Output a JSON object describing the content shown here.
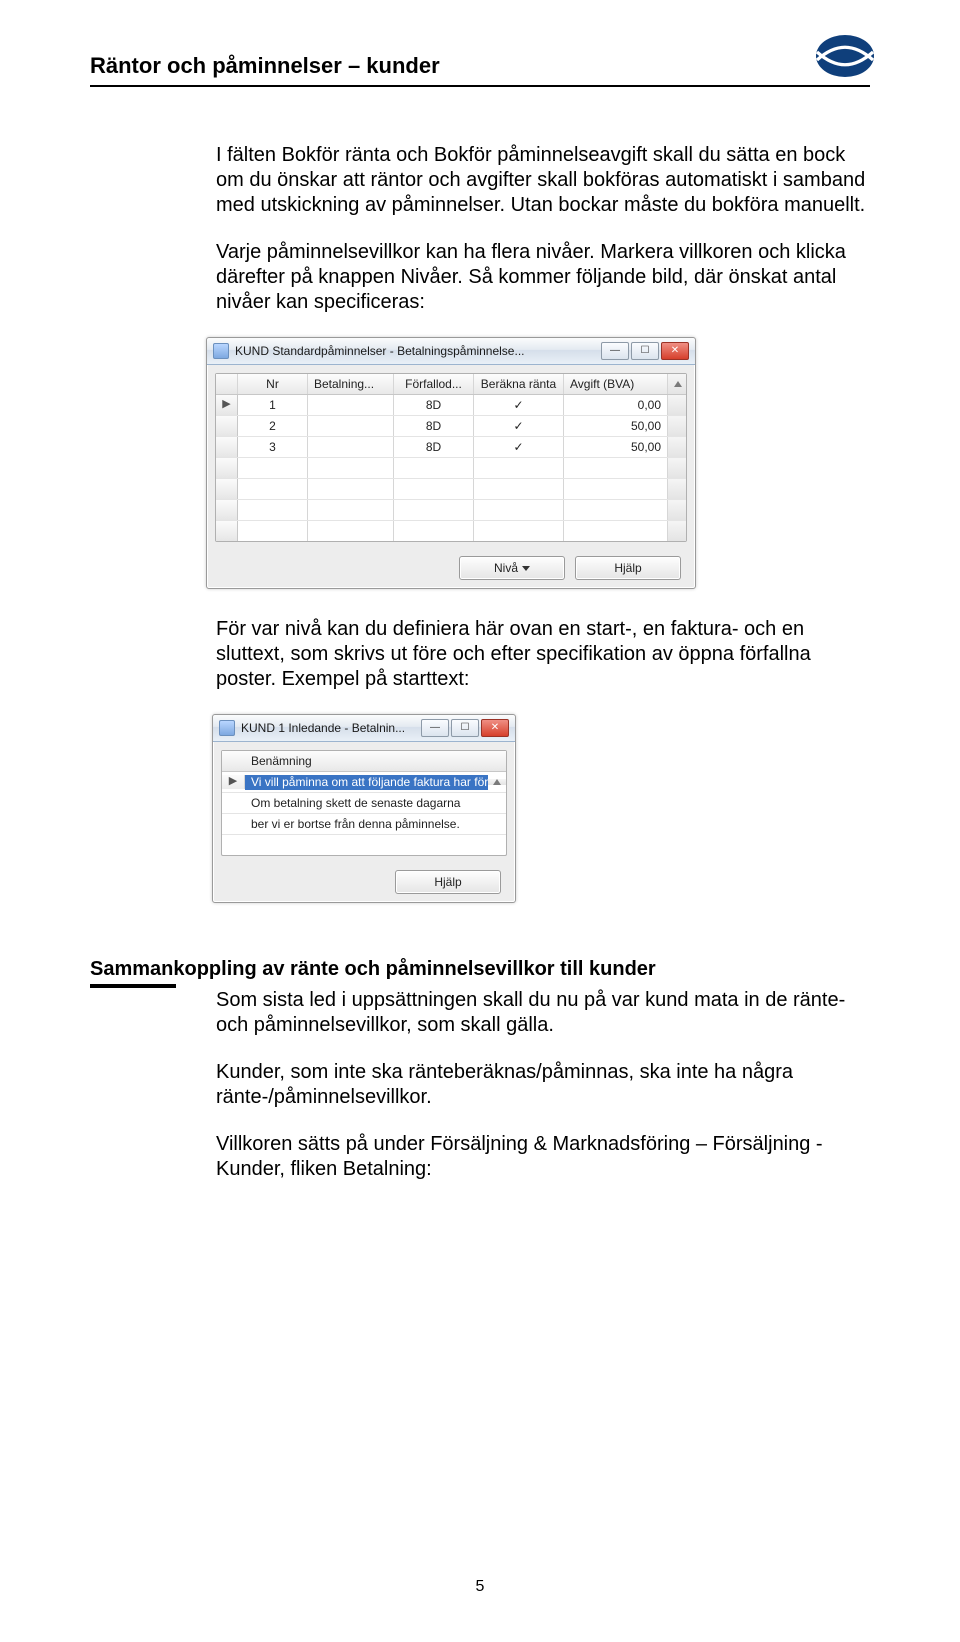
{
  "header": {
    "title": "Räntor och påminnelser – kunder"
  },
  "paragraphs": {
    "p1": "I fälten Bokför ränta och Bokför påminnelseavgift skall du sätta en bock om du önskar att räntor och avgifter skall bokföras automatiskt i samband med utskickning av påminnelser. Utan bockar måste du bokföra manuellt.",
    "p2": "Varje påminnelsevillkor kan ha flera nivåer. Markera villkoren och klicka därefter på knappen Nivåer. Så kommer följande bild, där önskat antal nivåer kan specificeras:",
    "p3": "För var nivå kan du definiera här ovan en start-, en faktura- och en sluttext, som skrivs ut före och efter specifikation av öppna förfallna poster. Exempel på starttext:"
  },
  "section2": {
    "heading": "Sammankoppling av ränte och påminnelsevillkor till kunder",
    "p1": "Som sista led i uppsättningen skall du nu på var kund mata in de ränte- och påminnelsevillkor, som skall gälla.",
    "p2": "Kunder, som inte ska ränteberäknas/påminnas, ska inte ha några ränte-/påminnelsevillkor.",
    "p3": "Villkoren sätts på under Försäljning & Marknadsföring – Försäljning - Kunder, fliken Betalning:"
  },
  "dialog1": {
    "title": "KUND Standardpåminnelser - Betalningspåminnelse...",
    "columns": {
      "nr": "Nr",
      "bet": "Betalning...",
      "ff": "Förfallod...",
      "br": "Beräkna ränta",
      "av": "Avgift (BVA)"
    },
    "rows": [
      {
        "nr": "1",
        "ff": "8D",
        "br": "✓",
        "av": "0,00"
      },
      {
        "nr": "2",
        "ff": "8D",
        "br": "✓",
        "av": "50,00"
      },
      {
        "nr": "3",
        "ff": "8D",
        "br": "✓",
        "av": "50,00"
      }
    ],
    "btn_niva": "Nivå",
    "btn_hjalp": "Hjälp"
  },
  "dialog2": {
    "title": "KUND 1 Inledande - Betalnin...",
    "col": "Benämning",
    "rows": [
      "Vi vill påminna om att följande faktura har för",
      "Om betalning skett de senaste dagarna",
      "ber vi er bortse från denna påminnelse."
    ],
    "btn_hjalp": "Hjälp"
  },
  "page_number": "5"
}
